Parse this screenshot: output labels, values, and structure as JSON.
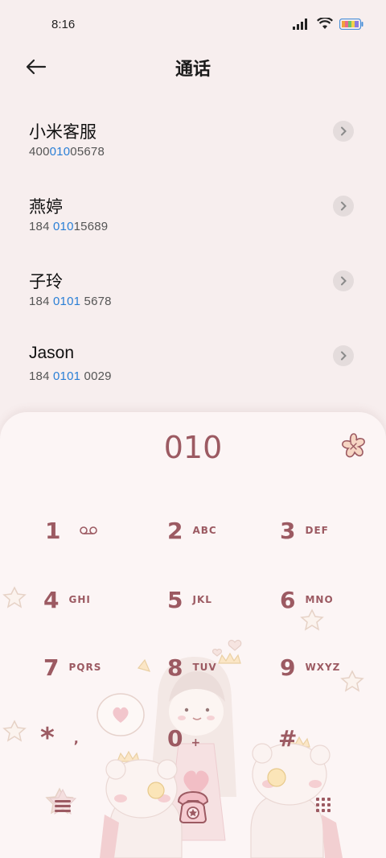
{
  "status": {
    "time": "8:16"
  },
  "header": {
    "title": "通话"
  },
  "contacts": [
    {
      "name": "小米客服",
      "num_pre": "400",
      "num_hl": "010",
      "num_post": "05678"
    },
    {
      "name": "燕婷",
      "num_pre": "184 ",
      "num_hl": "010",
      "num_post": "15689"
    },
    {
      "name": "子玲",
      "num_pre": "184 ",
      "num_hl": "0101",
      "num_post": " 5678"
    },
    {
      "name": "Jason",
      "num_pre": "184 ",
      "num_hl": "0101",
      "num_post": " 0029"
    }
  ],
  "dialpad": {
    "entered": "010",
    "keys": [
      {
        "digit": "1",
        "letters": ""
      },
      {
        "digit": "2",
        "letters": "ABC"
      },
      {
        "digit": "3",
        "letters": "DEF"
      },
      {
        "digit": "4",
        "letters": "GHI"
      },
      {
        "digit": "5",
        "letters": "JKL"
      },
      {
        "digit": "6",
        "letters": "MNO"
      },
      {
        "digit": "7",
        "letters": "PQRS"
      },
      {
        "digit": "8",
        "letters": "TUV"
      },
      {
        "digit": "9",
        "letters": "WXYZ"
      },
      {
        "digit": "*",
        "letters": ","
      },
      {
        "digit": "0",
        "letters": "+"
      },
      {
        "digit": "#",
        "letters": ""
      }
    ]
  },
  "colors": {
    "accent": "#9c5a62",
    "highlight": "#2a7fd6",
    "background": "#f7eeee"
  },
  "icons": [
    "back-arrow-icon",
    "chevron-right-icon",
    "voicemail-icon",
    "flower-icon",
    "menu-icon",
    "call-icon",
    "keypad-icon"
  ]
}
